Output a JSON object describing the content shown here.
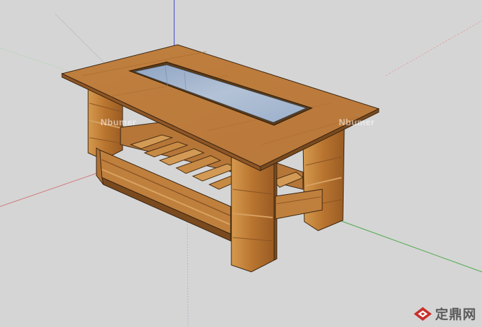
{
  "viewport": {
    "background": "#d5d5d5",
    "axis_colors": {
      "red": "#d88a8a",
      "green": "#4aa84a",
      "blue": "#3b3bcf"
    }
  },
  "model": {
    "wood_light": "#c88a46",
    "wood_mid": "#a9692f",
    "wood_dark": "#7a4a1f",
    "glass": "#9fb4cf"
  },
  "watermarks": {
    "left": "Nbumer",
    "right": "Nbumer"
  },
  "brand": {
    "text": "定鼎网",
    "logo_color": "#c9302c"
  }
}
